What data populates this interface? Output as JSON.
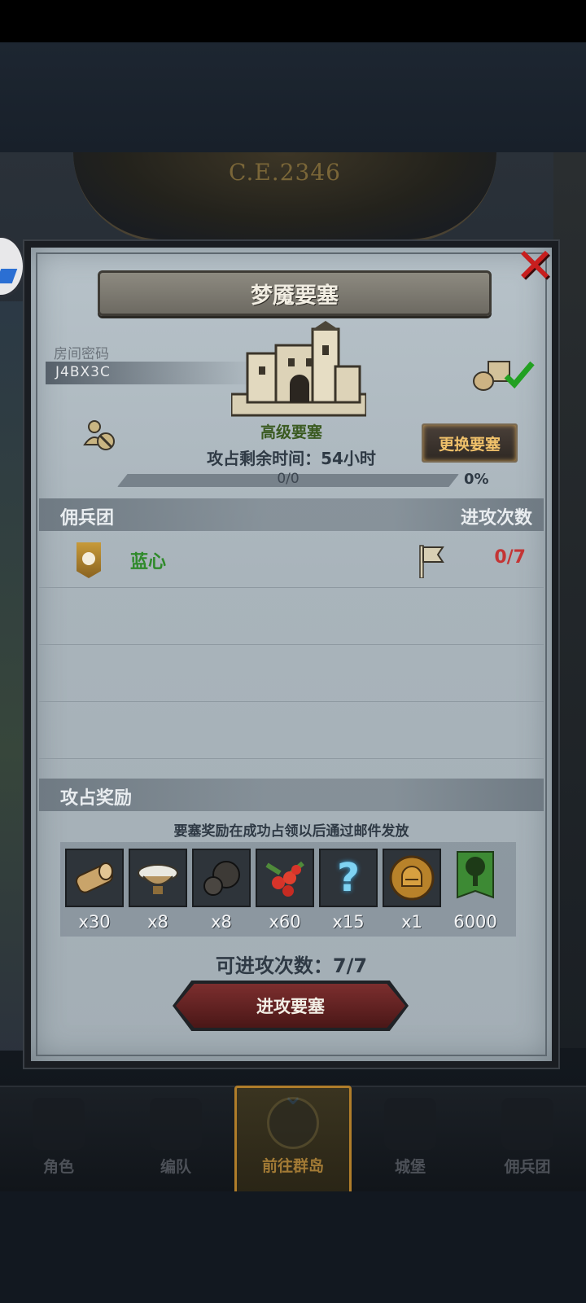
{
  "header": {
    "year": "C.E.2346"
  },
  "dialog": {
    "title": "梦魇要塞",
    "room_label": "房间密码",
    "room_code": "J4BX3C",
    "fortress_grade": "高级要塞",
    "capture_time": "攻占剩余时间：54小时",
    "change_button": "更换要塞",
    "progress": {
      "text": "0/0",
      "percent_label": "0%",
      "fraction": 0
    },
    "mercenary_section": {
      "left": "佣兵团",
      "right": "进攻次数"
    },
    "mercenaries": [
      {
        "name": "蓝心",
        "attacks": "0/7"
      }
    ],
    "reward_section": {
      "title": "攻占奖励"
    },
    "reward_note": "要塞奖励在成功占领以后通过邮件发放",
    "rewards": [
      {
        "icon": "log-icon",
        "qty": "x30"
      },
      {
        "icon": "bowl-icon",
        "qty": "x8"
      },
      {
        "icon": "ore-icon",
        "qty": "x8"
      },
      {
        "icon": "berries-icon",
        "qty": "x60"
      },
      {
        "icon": "mystery-question-icon",
        "qty": "x15"
      },
      {
        "icon": "helmet-coin-icon",
        "qty": "x1"
      },
      {
        "icon": "tree-banner-icon",
        "qty": "6000"
      }
    ],
    "attacks_available": "可进攻次数：7/7",
    "attack_button": "进攻要塞"
  },
  "bottom_nav": [
    {
      "label": "角色",
      "icon": "knight-icon",
      "active": false
    },
    {
      "label": "编队",
      "icon": "helmet-icon",
      "active": false
    },
    {
      "label": "前往群岛",
      "icon": "globe-icon",
      "active": true
    },
    {
      "label": "城堡",
      "icon": "castle-icon",
      "active": false
    },
    {
      "label": "佣兵团",
      "icon": "ship-icon",
      "active": false
    }
  ],
  "colors": {
    "attack_button": "#6a2424",
    "merc_name": "#2f8a2a",
    "attack_count": "#c43434",
    "change_button_text": "#f0c16a"
  }
}
